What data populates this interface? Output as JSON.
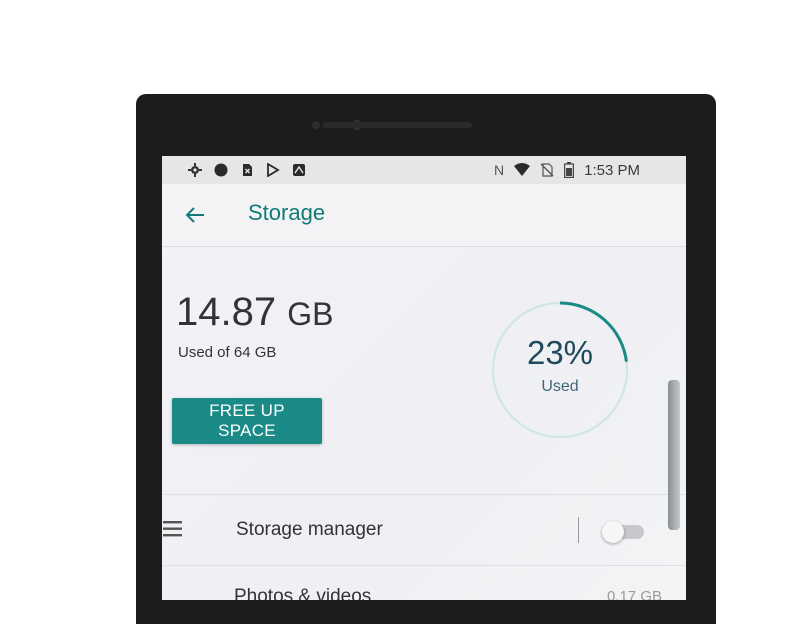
{
  "status_bar": {
    "left_icons": [
      "settings-icon",
      "record-dot-icon",
      "sim-x-icon",
      "play-store-icon",
      "app-badge-icon"
    ],
    "right_icons": [
      "nfc-icon",
      "wifi-icon",
      "no-sim-icon",
      "battery-icon"
    ],
    "time": "1:53 PM",
    "nfc_label": "N"
  },
  "app_bar": {
    "back_icon": "arrow-left-icon",
    "title": "Storage"
  },
  "summary": {
    "used_value": "14.87",
    "used_unit": "GB",
    "used_of": "Used of 64 GB",
    "free_button": "FREE UP SPACE",
    "percent_text": "23%",
    "percent_label": "Used",
    "percent_fraction": 0.23
  },
  "list": [
    {
      "label": "Storage manager",
      "icon": "menu-list-icon",
      "toggle_on": false
    },
    {
      "label": "Photos & videos",
      "value": "0.17 GB"
    }
  ],
  "colors": {
    "accent": "#127a77",
    "button": "#1a8a86",
    "ring_track": "#cfe6e5",
    "ring_fill": "#1a8a86"
  }
}
